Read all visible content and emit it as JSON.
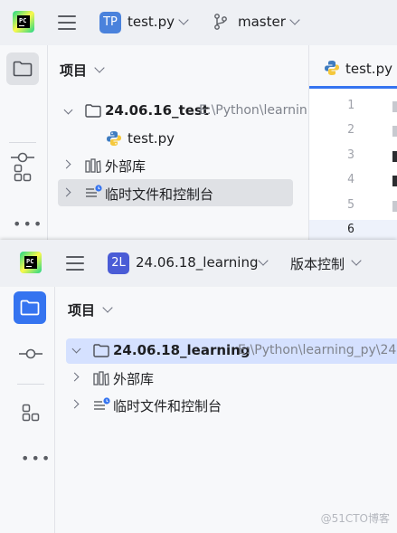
{
  "back_window": {
    "project": {
      "badge": "TP",
      "name": "test.py",
      "badge_color": "#4a82dc"
    },
    "vcs": {
      "label": "master"
    },
    "panel_title": "项目",
    "tree": [
      {
        "label": "24.06.16_test",
        "path": "E:\\Python\\learnin"
      },
      {
        "label": "test.py"
      },
      {
        "label": "外部库"
      },
      {
        "label": "临时文件和控制台"
      }
    ],
    "editor": {
      "tab": "test.py",
      "line_numbers": [
        "1",
        "2",
        "3",
        "4",
        "5",
        "6"
      ]
    }
  },
  "front_window": {
    "project": {
      "badge": "2L",
      "name": "24.06.18_learning",
      "badge_color": "#4a5cd6"
    },
    "vcs": {
      "label": "版本控制"
    },
    "panel_title": "项目",
    "tree": [
      {
        "label": "24.06.18_learning",
        "path": "E:\\Python\\learning_py\\24"
      },
      {
        "label": "外部库"
      },
      {
        "label": "临时文件和控制台"
      }
    ]
  },
  "watermark": "@51CTO博客",
  "colors": {
    "accent": "#3574f0",
    "selection": "#dfe1e5",
    "tree_selection": "#d5e1ff"
  }
}
